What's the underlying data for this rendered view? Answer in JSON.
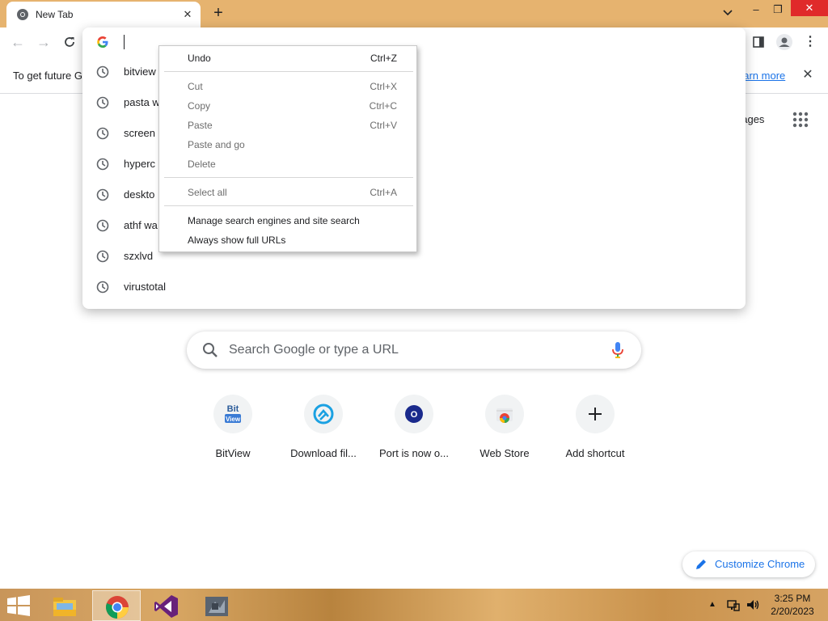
{
  "browser": {
    "tab": {
      "title": "New Tab"
    },
    "infobar": {
      "text": "To get future G",
      "learn_more": "earn more"
    },
    "omnibox": {
      "value": "",
      "suggestions": [
        {
          "text": "bitview",
          "icon": "history-clock-icon"
        },
        {
          "text": "pasta w",
          "icon": "history-clock-icon"
        },
        {
          "text": "screen",
          "icon": "history-clock-icon"
        },
        {
          "text": "hyperc",
          "icon": "history-clock-icon"
        },
        {
          "text": "deskto",
          "icon": "history-clock-icon"
        },
        {
          "text": "athf wa",
          "icon": "history-clock-icon"
        },
        {
          "text": "szxlvd",
          "icon": "history-clock-icon"
        },
        {
          "text": "virustotal",
          "icon": "history-clock-icon"
        }
      ]
    },
    "context_menu": {
      "items": [
        {
          "label": "Undo",
          "shortcut": "Ctrl+Z",
          "enabled": true
        },
        {
          "label": "Cut",
          "shortcut": "Ctrl+X",
          "enabled": false
        },
        {
          "label": "Copy",
          "shortcut": "Ctrl+C",
          "enabled": false
        },
        {
          "label": "Paste",
          "shortcut": "Ctrl+V",
          "enabled": false
        },
        {
          "label": "Paste and go",
          "shortcut": "",
          "enabled": false
        },
        {
          "label": "Delete",
          "shortcut": "",
          "enabled": false
        },
        {
          "label": "Select all",
          "shortcut": "Ctrl+A",
          "enabled": false
        },
        {
          "label": "Manage search engines and site search",
          "shortcut": "",
          "enabled": true
        },
        {
          "label": "Always show full URLs",
          "shortcut": "",
          "enabled": true
        }
      ]
    }
  },
  "ntp": {
    "images_link": "nages",
    "search_placeholder": "Search Google or type a URL",
    "shortcuts": [
      {
        "label": "BitView",
        "icon": "bitview-favicon-icon"
      },
      {
        "label": "Download fil...",
        "icon": "download-site-favicon-icon"
      },
      {
        "label": "Port is now o...",
        "icon": "port-letter-o-icon",
        "letter": "O"
      },
      {
        "label": "Web Store",
        "icon": "chrome-web-store-icon"
      },
      {
        "label": "Add shortcut",
        "icon": "plus-icon"
      }
    ],
    "customize_label": "Customize Chrome"
  },
  "taskbar": {
    "apps": [
      {
        "name": "File Explorer",
        "icon": "file-explorer-icon"
      },
      {
        "name": "Google Chrome",
        "icon": "chrome-icon",
        "active": true
      },
      {
        "name": "Visual Studio",
        "icon": "visual-studio-icon"
      },
      {
        "name": "Unknown app",
        "icon": "app-thumbnail-icon"
      }
    ],
    "clock": {
      "time": "3:25 PM",
      "date": "2/20/2023"
    }
  },
  "colors": {
    "titlebar": "#e6b36f",
    "accent": "#1a73e8",
    "close_button": "#e02a2a"
  }
}
